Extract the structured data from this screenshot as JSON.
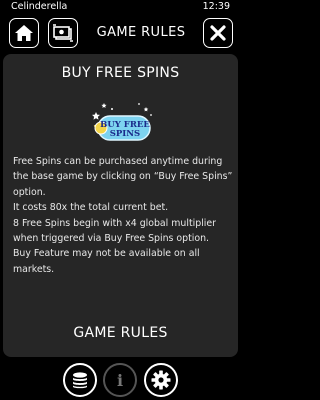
{
  "status_bar": {
    "app_name": "Celinderella",
    "time": "12:39"
  },
  "header": {
    "title": "GAME RULES",
    "icons": {
      "home": "home-icon",
      "transaction": "transaction-history-icon",
      "close": "close-icon"
    }
  },
  "panel": {
    "heading": "BUY FREE SPINS",
    "logo_text_line1": "BUY FREE",
    "logo_text_line2": "SPINS",
    "paragraphs": [
      "Free Spins can be purchased anytime during the base game by clicking on “Buy Free Spins” option.",
      "It costs 80x the total current bet.",
      "8 Free Spins begin with x4 global multiplier when triggered via Buy Free Spins option.",
      "Buy Feature may not be available on all markets."
    ],
    "next_heading": "GAME RULES"
  },
  "footer": {
    "icons": {
      "coins": "coins-icon",
      "info": "info-icon",
      "settings": "gear-icon"
    },
    "info_glyph": "i"
  },
  "colors": {
    "background": "#000000",
    "panel": "#262626",
    "logo_fill": "#7dd3f0",
    "logo_text": "#1a2a8a"
  }
}
